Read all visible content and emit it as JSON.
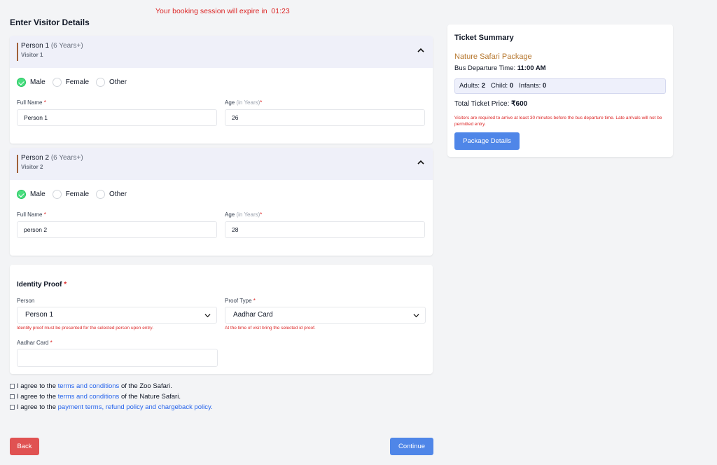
{
  "session": {
    "text": "Your booking session will expire in",
    "timer": "01:23"
  },
  "page": {
    "title": "Enter Visitor Details"
  },
  "persons": [
    {
      "title": "Person 1",
      "age_range": "(6 Years+)",
      "subtitle": "Visitor 1",
      "genders": [
        "Male",
        "Female",
        "Other"
      ],
      "selected_gender": "Male",
      "full_name_label": "Full Name",
      "full_name": "Person 1",
      "age_label": "Age",
      "age_unit": "(in Years)",
      "age": "26"
    },
    {
      "title": "Person 2",
      "age_range": "(6 Years+)",
      "subtitle": "Visitor 2",
      "genders": [
        "Male",
        "Female",
        "Other"
      ],
      "selected_gender": "Male",
      "full_name_label": "Full Name",
      "full_name": "person 2",
      "age_label": "Age",
      "age_unit": "(in Years)",
      "age": "28"
    }
  ],
  "identity": {
    "title": "Identity Proof",
    "person_label": "Person",
    "person_value": "Person 1",
    "person_hint": "Identity proof must be presented for the selected person upon entry.",
    "proof_label": "Proof Type",
    "proof_value": "Aadhar Card",
    "proof_hint": "At the time of visit bring the selected id proof.",
    "card_label": "Aadhar Card",
    "card_value": ""
  },
  "summary": {
    "title": "Ticket Summary",
    "package": "Nature Safari Package",
    "departure_label": "Bus Departure Time:",
    "departure_time": "11:00 AM",
    "adults_label": "Adults:",
    "adults": "2",
    "child_label": "Child:",
    "child": "0",
    "infants_label": "Infants:",
    "infants": "0",
    "total_label": "Total Ticket Price:",
    "total": "₹600",
    "warning": "Visitors are required to arrive at least 30 minutes before the bus departure time. Late arrivals will not be permitted entry.",
    "button": "Package Details"
  },
  "agreements": [
    {
      "prefix": "I agree to the",
      "link": "terms and conditions",
      "suffix": "of the Zoo Safari.",
      "checked": false
    },
    {
      "prefix": "I agree to the",
      "link": "terms and conditions",
      "suffix": "of the Nature Safari.",
      "checked": false
    },
    {
      "prefix": "I agree to the",
      "link": "payment terms, refund policy and chargeback policy.",
      "suffix": "",
      "checked": false
    }
  ],
  "actions": {
    "back": "Back",
    "continue": "Continue"
  },
  "colors": {
    "accent": "#4f86e8",
    "danger": "#e05252",
    "brand": "#b7782f",
    "success": "#4ade80"
  }
}
